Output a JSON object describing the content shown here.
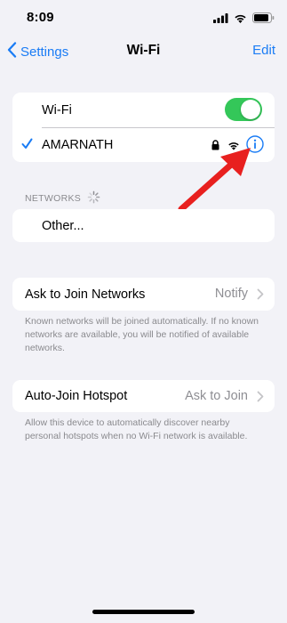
{
  "status_bar": {
    "time": "8:09"
  },
  "nav": {
    "back_label": "Settings",
    "title": "Wi-Fi",
    "edit_label": "Edit"
  },
  "wifi": {
    "toggle_label": "Wi-Fi",
    "toggle_on": true,
    "connected_network": "AMARNATH"
  },
  "networks": {
    "header": "NETWORKS",
    "other_label": "Other..."
  },
  "ask_to_join": {
    "label": "Ask to Join Networks",
    "value": "Notify",
    "footer": "Known networks will be joined automatically. If no known networks are available, you will be notified of available networks."
  },
  "auto_join": {
    "label": "Auto-Join Hotspot",
    "value": "Ask to Join",
    "footer": "Allow this device to automatically discover nearby personal hotspots when no Wi-Fi network is available."
  },
  "colors": {
    "accent": "#1a7cf5",
    "toggle_on": "#34c759",
    "annotation_arrow": "#e8201f",
    "background": "#f2f2f7"
  }
}
